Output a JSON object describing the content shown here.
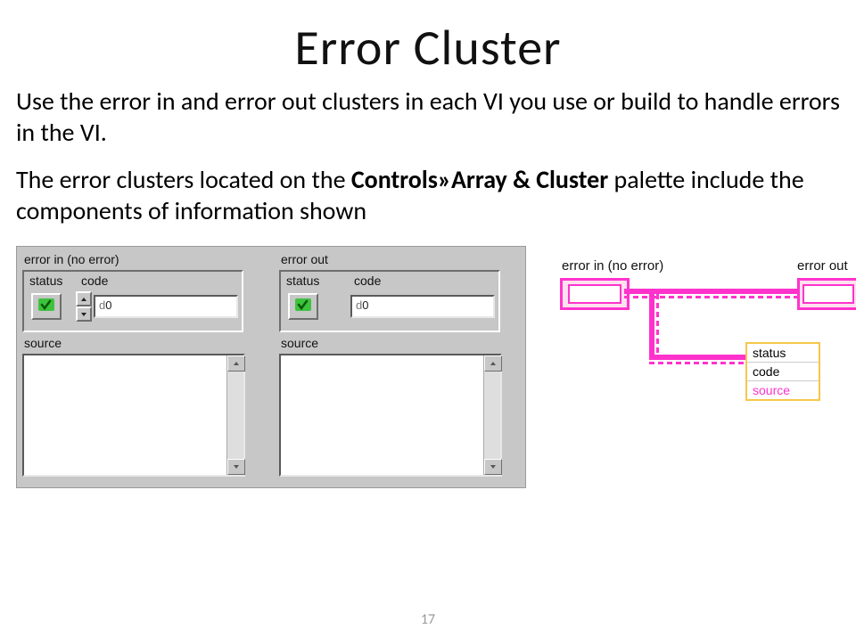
{
  "title": "Error Cluster",
  "body": {
    "p1": "Use the error in and error out clusters in each VI you use or build to handle errors in the VI.",
    "p2_a": "The error clusters located on the ",
    "p2_b": "Controls»Array & Cluster",
    "p2_c": " palette include the components of information shown"
  },
  "panel": {
    "error_in_title": "error in (no error)",
    "error_out_title": "error out",
    "status_label": "status",
    "code_label": "code",
    "source_label": "source",
    "code_value": "0",
    "code_prefix": "d"
  },
  "diagram": {
    "error_in_label": "error in (no error)",
    "error_out_label": "error out",
    "rows": {
      "status": "status",
      "code": "code",
      "source": "source"
    }
  },
  "page_number": "17"
}
